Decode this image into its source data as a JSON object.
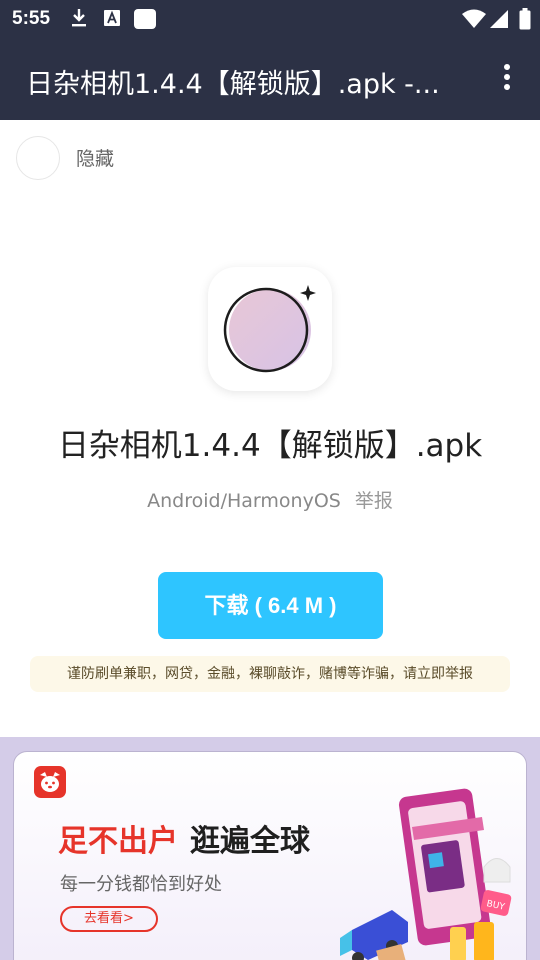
{
  "status_bar": {
    "time": "5:55",
    "icons": [
      "download-icon",
      "text-a-icon",
      "square-icon",
      "wifi-icon",
      "signal-icon",
      "battery-icon"
    ],
    "background": "#2c3145"
  },
  "app_bar": {
    "title": "日杂相机1.4.4【解锁版】.apk -...",
    "menu_icon": "more-vert-icon"
  },
  "hide": {
    "label": "隐藏"
  },
  "app": {
    "name": "日杂相机1.4.4【解锁版】.apk",
    "platform": "Android/HarmonyOS",
    "report": "举报",
    "icon": "camera-lens-sparkle-icon"
  },
  "download": {
    "label": "下载 ( 6.4 M )",
    "color": "#2ec5ff"
  },
  "warning": {
    "text": "谨防刷单兼职，网贷，金融，裸聊敲诈，赌博等诈骗，请立即举报",
    "background": "#fdf8e8"
  },
  "ad": {
    "headline_red": "足不出户",
    "headline_dark": "逛遍全球",
    "subtitle": "每一分钱都恰到好处",
    "cta": "去看看>",
    "art_text": "BUY",
    "accent": "#e6342a"
  }
}
